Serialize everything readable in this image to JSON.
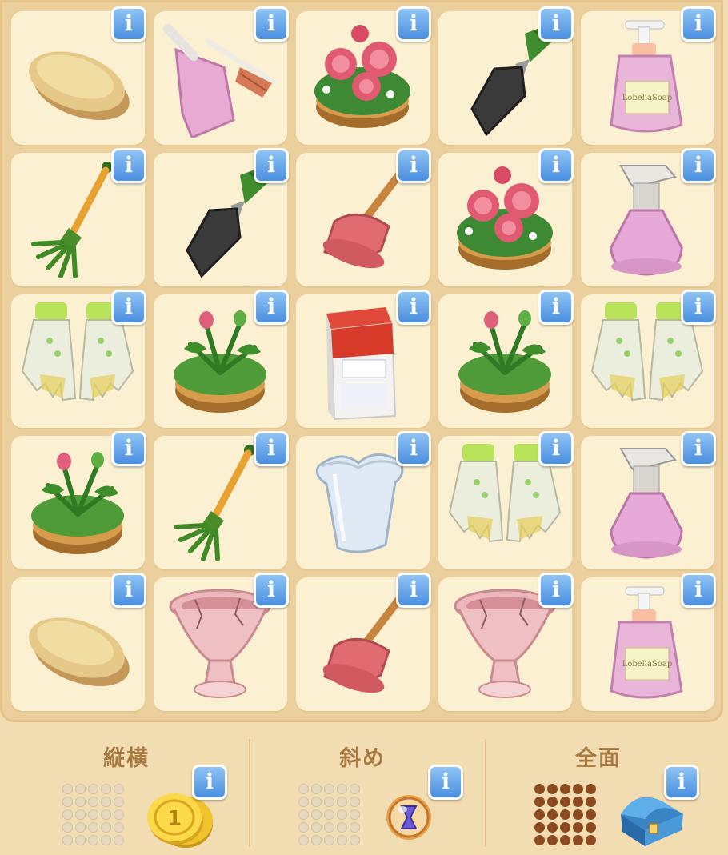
{
  "grid": {
    "info_label": "i",
    "rows": [
      [
        "soap",
        "dustpan-brush",
        "pink-flower-pot",
        "garden-trowel",
        "pump-soap-bottle"
      ],
      [
        "garden-rake",
        "garden-trowel",
        "plunger",
        "pink-flower-pot",
        "spray-bottle"
      ],
      [
        "garden-gloves",
        "bud-flower-pot",
        "detergent-box",
        "bud-flower-pot",
        "garden-gloves"
      ],
      [
        "bud-flower-pot",
        "garden-rake",
        "glass-vase",
        "garden-gloves",
        "spray-bottle"
      ],
      [
        "soap",
        "cracked-pink-vase",
        "plunger",
        "cracked-pink-vase",
        "pump-soap-bottle"
      ]
    ],
    "soap_label": "LobeliaSoap"
  },
  "footer": {
    "sections": [
      {
        "label": "縦横",
        "pattern": "light",
        "reward_icon": "gold-coin-icon",
        "coin_text": "1"
      },
      {
        "label": "斜め",
        "pattern": "light",
        "reward_icon": "hourglass-orb-icon"
      },
      {
        "label": "全面",
        "pattern": "full",
        "reward_icon": "blue-treasure-chest-icon"
      }
    ]
  }
}
